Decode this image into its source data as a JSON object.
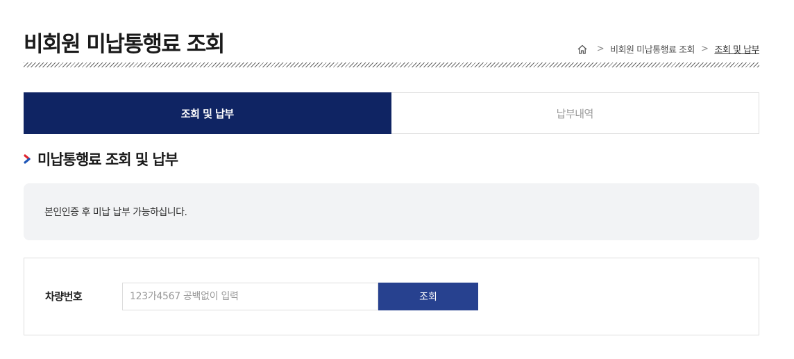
{
  "page": {
    "title": "비회원 미납통행료 조회"
  },
  "breadcrumb": {
    "home_icon": "home-icon",
    "items": [
      "비회원 미납통행료 조회",
      "조회 및 납부"
    ]
  },
  "tabs": [
    {
      "label": "조회 및 납부",
      "active": true
    },
    {
      "label": "납부내역",
      "active": false
    }
  ],
  "section": {
    "title": "미납통행료 조회 및 납부",
    "icon": "chevron-right-icon"
  },
  "notice": {
    "text": "본인인증 후 미납 납부 가능하십니다."
  },
  "form": {
    "label": "차량번호",
    "placeholder": "123가4567 공백없이 입력",
    "value": "",
    "button_label": "조회"
  },
  "colors": {
    "active_tab": "#0f2463",
    "button": "#27418f",
    "chevron_red": "#e0252f",
    "chevron_blue": "#1f57b8"
  }
}
